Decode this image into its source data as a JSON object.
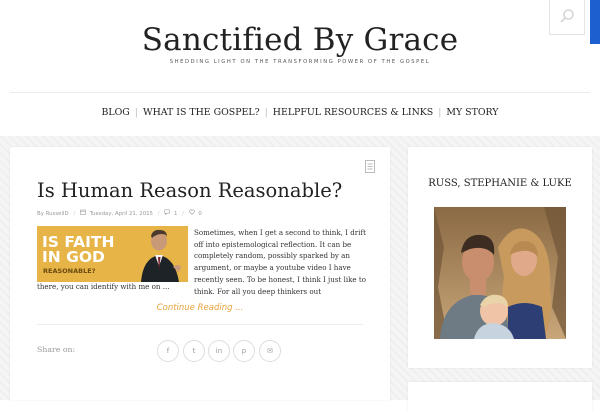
{
  "site": {
    "title": "Sanctified By Grace",
    "tagline": "SHEDDING LIGHT ON THE TRANSFORMING POWER OF THE GOSPEL"
  },
  "nav": {
    "items": [
      {
        "label": "BLOG"
      },
      {
        "label": "WHAT IS THE GOSPEL?"
      },
      {
        "label": "HELPFUL RESOURCES & LINKS"
      },
      {
        "label": "MY STORY"
      }
    ],
    "separator": "|"
  },
  "post": {
    "title": "Is Human Reason Reasonable?",
    "meta": {
      "author": "By RussellD",
      "date": "Tuesday, April 21, 2015",
      "comments": "1",
      "likes": "0",
      "sep": "/"
    },
    "thumbnail": {
      "line1": "IS FAITH",
      "line2": "IN GOD",
      "line3": "REASONABLE?",
      "background": "#e7b447"
    },
    "excerpt": "Sometimes, when I get a second to think, I drift off into epistemological reflection. It can be completely random, possibly sparked by an argument, or maybe a youtube video I have recently seen. To be honest, I think I just like to think. For all you deep thinkers out",
    "excerpt_tail": "there, you can identify with me on ...",
    "read_more": "Continue Reading ...",
    "share_label": "Share on:",
    "share_buttons": [
      {
        "icon": "facebook-icon",
        "glyph": "f"
      },
      {
        "icon": "twitter-icon",
        "glyph": "t"
      },
      {
        "icon": "linkedin-icon",
        "glyph": "in"
      },
      {
        "icon": "pinterest-icon",
        "glyph": "p"
      },
      {
        "icon": "email-icon",
        "glyph": "✉"
      }
    ]
  },
  "sidebar": {
    "title": "RUSS, STEPHANIE & LUKE"
  },
  "colors": {
    "accent": "#e9a23b",
    "search_edge": "#1e5fd0"
  }
}
